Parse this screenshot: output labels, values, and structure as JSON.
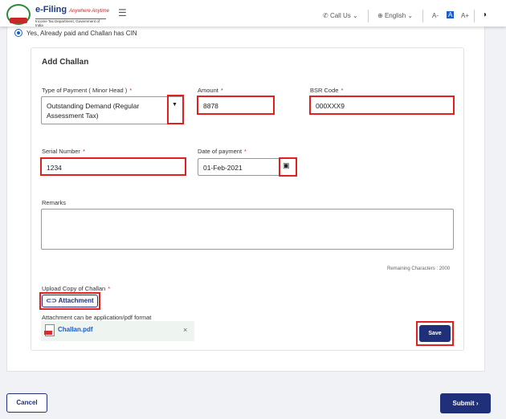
{
  "header": {
    "brand": "e-Filing",
    "tagline": "Anywhere Anytime",
    "subtitle": "Income Tax Department, Government of India",
    "call_us": "Call Us",
    "language": "English",
    "font_small": "A-",
    "font_normal": "A",
    "font_large": "A+"
  },
  "payment_option": "Yes, Already paid and Challan has CIN",
  "form": {
    "title": "Add Challan",
    "type_label": "Type of Payment ( Minor Head )",
    "type_value": "Outstanding Demand (Regular Assessment Tax)",
    "amount_label": "Amount",
    "amount_value": "8878",
    "bsr_label": "BSR Code",
    "bsr_value": "000XXX9",
    "serial_label": "Serial Number",
    "serial_value": "1234",
    "date_label": "Date of payment",
    "date_value": "01-Feb-2021",
    "remarks_label": "Remarks",
    "remaining": "Remaining Characters : 2000",
    "upload_label": "Upload Copy of Challan",
    "attachment_button": "Attachment",
    "format_hint": "Attachment can be application/pdf format",
    "file_name": "Challan.pdf",
    "save": "Save",
    "required_mark": "*"
  },
  "footer": {
    "cancel": "Cancel",
    "submit": "Submit"
  },
  "colors": {
    "primary": "#1f2f7a",
    "highlight": "#e32020"
  }
}
